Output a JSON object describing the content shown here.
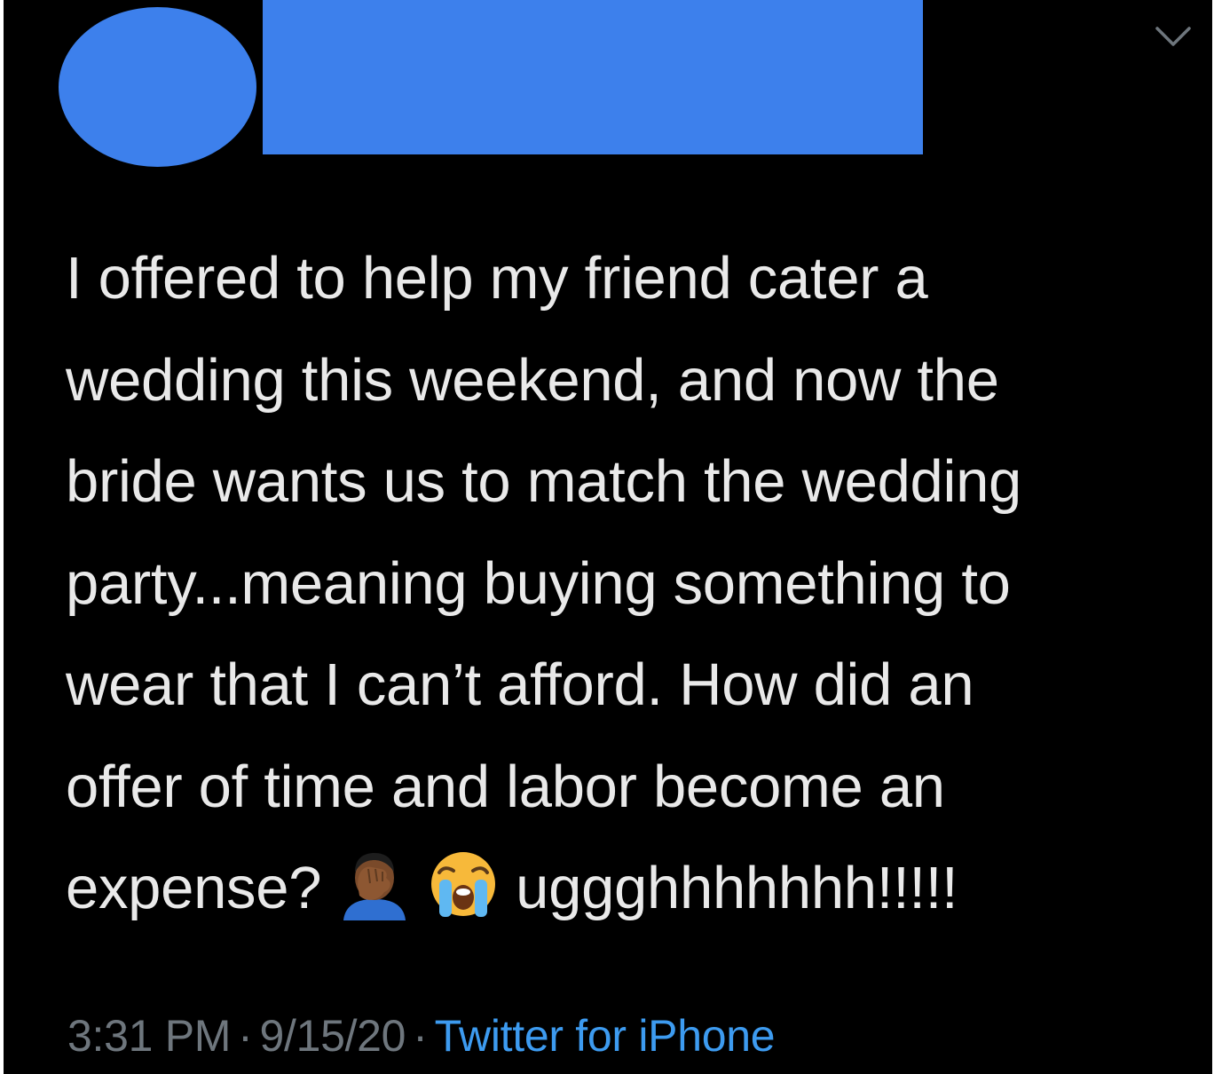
{
  "tweet": {
    "lines": [
      "I offered to help my friend cater a",
      "wedding this weekend, and now the",
      "bride wants us to match the wedding",
      "party...meaning buying something to",
      "wear that I can’t afford. How did an",
      "offer of time and labor become an"
    ],
    "last_line_start": "expense?",
    "last_line_end": "uggghhhhhhh!!!!!",
    "emojis": [
      "man-facepalming-icon",
      "loudly-crying-face-icon"
    ]
  },
  "meta": {
    "time": "3:31 PM",
    "separator": "·",
    "date": "9/15/20",
    "source": "Twitter for iPhone"
  },
  "colors": {
    "background": "#000000",
    "redaction": "#3d80ec",
    "text": "#e9e9e9",
    "meta": "#6e767d",
    "link": "#3d9bf0"
  }
}
